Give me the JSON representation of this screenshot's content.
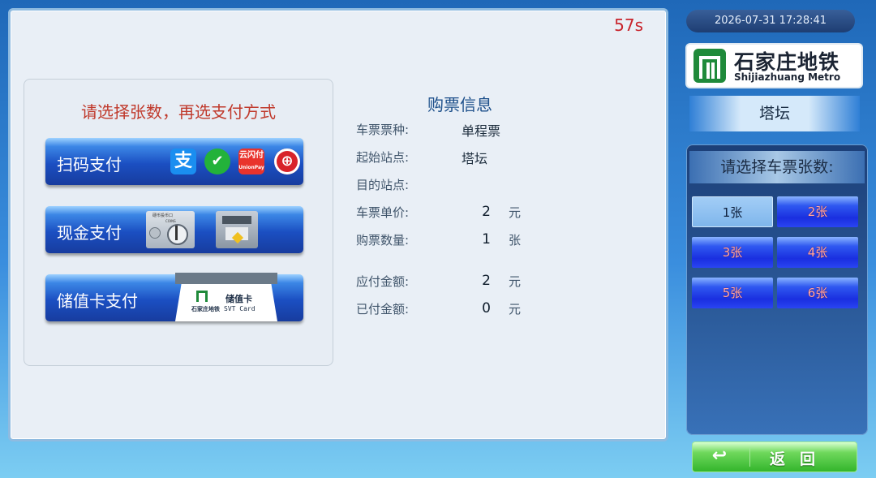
{
  "header": {
    "countdown": "57s"
  },
  "payment": {
    "prompt": "请选择张数，再选支付方式",
    "qr_label": "扫码支付",
    "cash_label": "现金支付",
    "card_label": "储值卡支付",
    "card_graphic": {
      "title": "储值卡",
      "subtitle": "SVT Card",
      "brand": "石家庄地铁"
    },
    "cash_graphic": {
      "slot_text": "硬币投币口",
      "coin": "COINS"
    }
  },
  "info": {
    "title": "购票信息",
    "ticket_type_label": "车票票种:",
    "ticket_type": "单程票",
    "origin_label": "起始站点:",
    "origin": "塔坛",
    "destination_label": "目的站点:",
    "destination": "",
    "unit_price_label": "车票单价:",
    "unit_price": "2",
    "unit_price_unit": "元",
    "quantity_label": "购票数量:",
    "quantity": "1",
    "quantity_unit": "张",
    "payable_label": "应付金额:",
    "payable": "2",
    "payable_unit": "元",
    "paid_label": "已付金额:",
    "paid": "0",
    "paid_unit": "元"
  },
  "sidebar": {
    "datetime": "2026-07-31 17:28:41",
    "logo_cn": "石家庄地铁",
    "logo_en": "Shijiazhuang Metro",
    "station": "塔坛",
    "qty_prompt": "请选择车票张数:",
    "qty_options": [
      "1张",
      "2张",
      "3张",
      "4张",
      "5张",
      "6张"
    ],
    "selected_qty": "1张",
    "back_label": "返回"
  },
  "colors": {
    "countdown": "#c8232b",
    "prompt": "#c0392b",
    "pay_button": "#1b4fc2",
    "back_button": "#33b52c",
    "logo_green": "#1f8a3a"
  },
  "icons": [
    "alipay-icon",
    "wechat-pay-icon",
    "unionpay-quickpass-icon",
    "rail-transit-icon",
    "coin-slot-icon",
    "cash-machine-icon",
    "back-arrow-icon"
  ]
}
